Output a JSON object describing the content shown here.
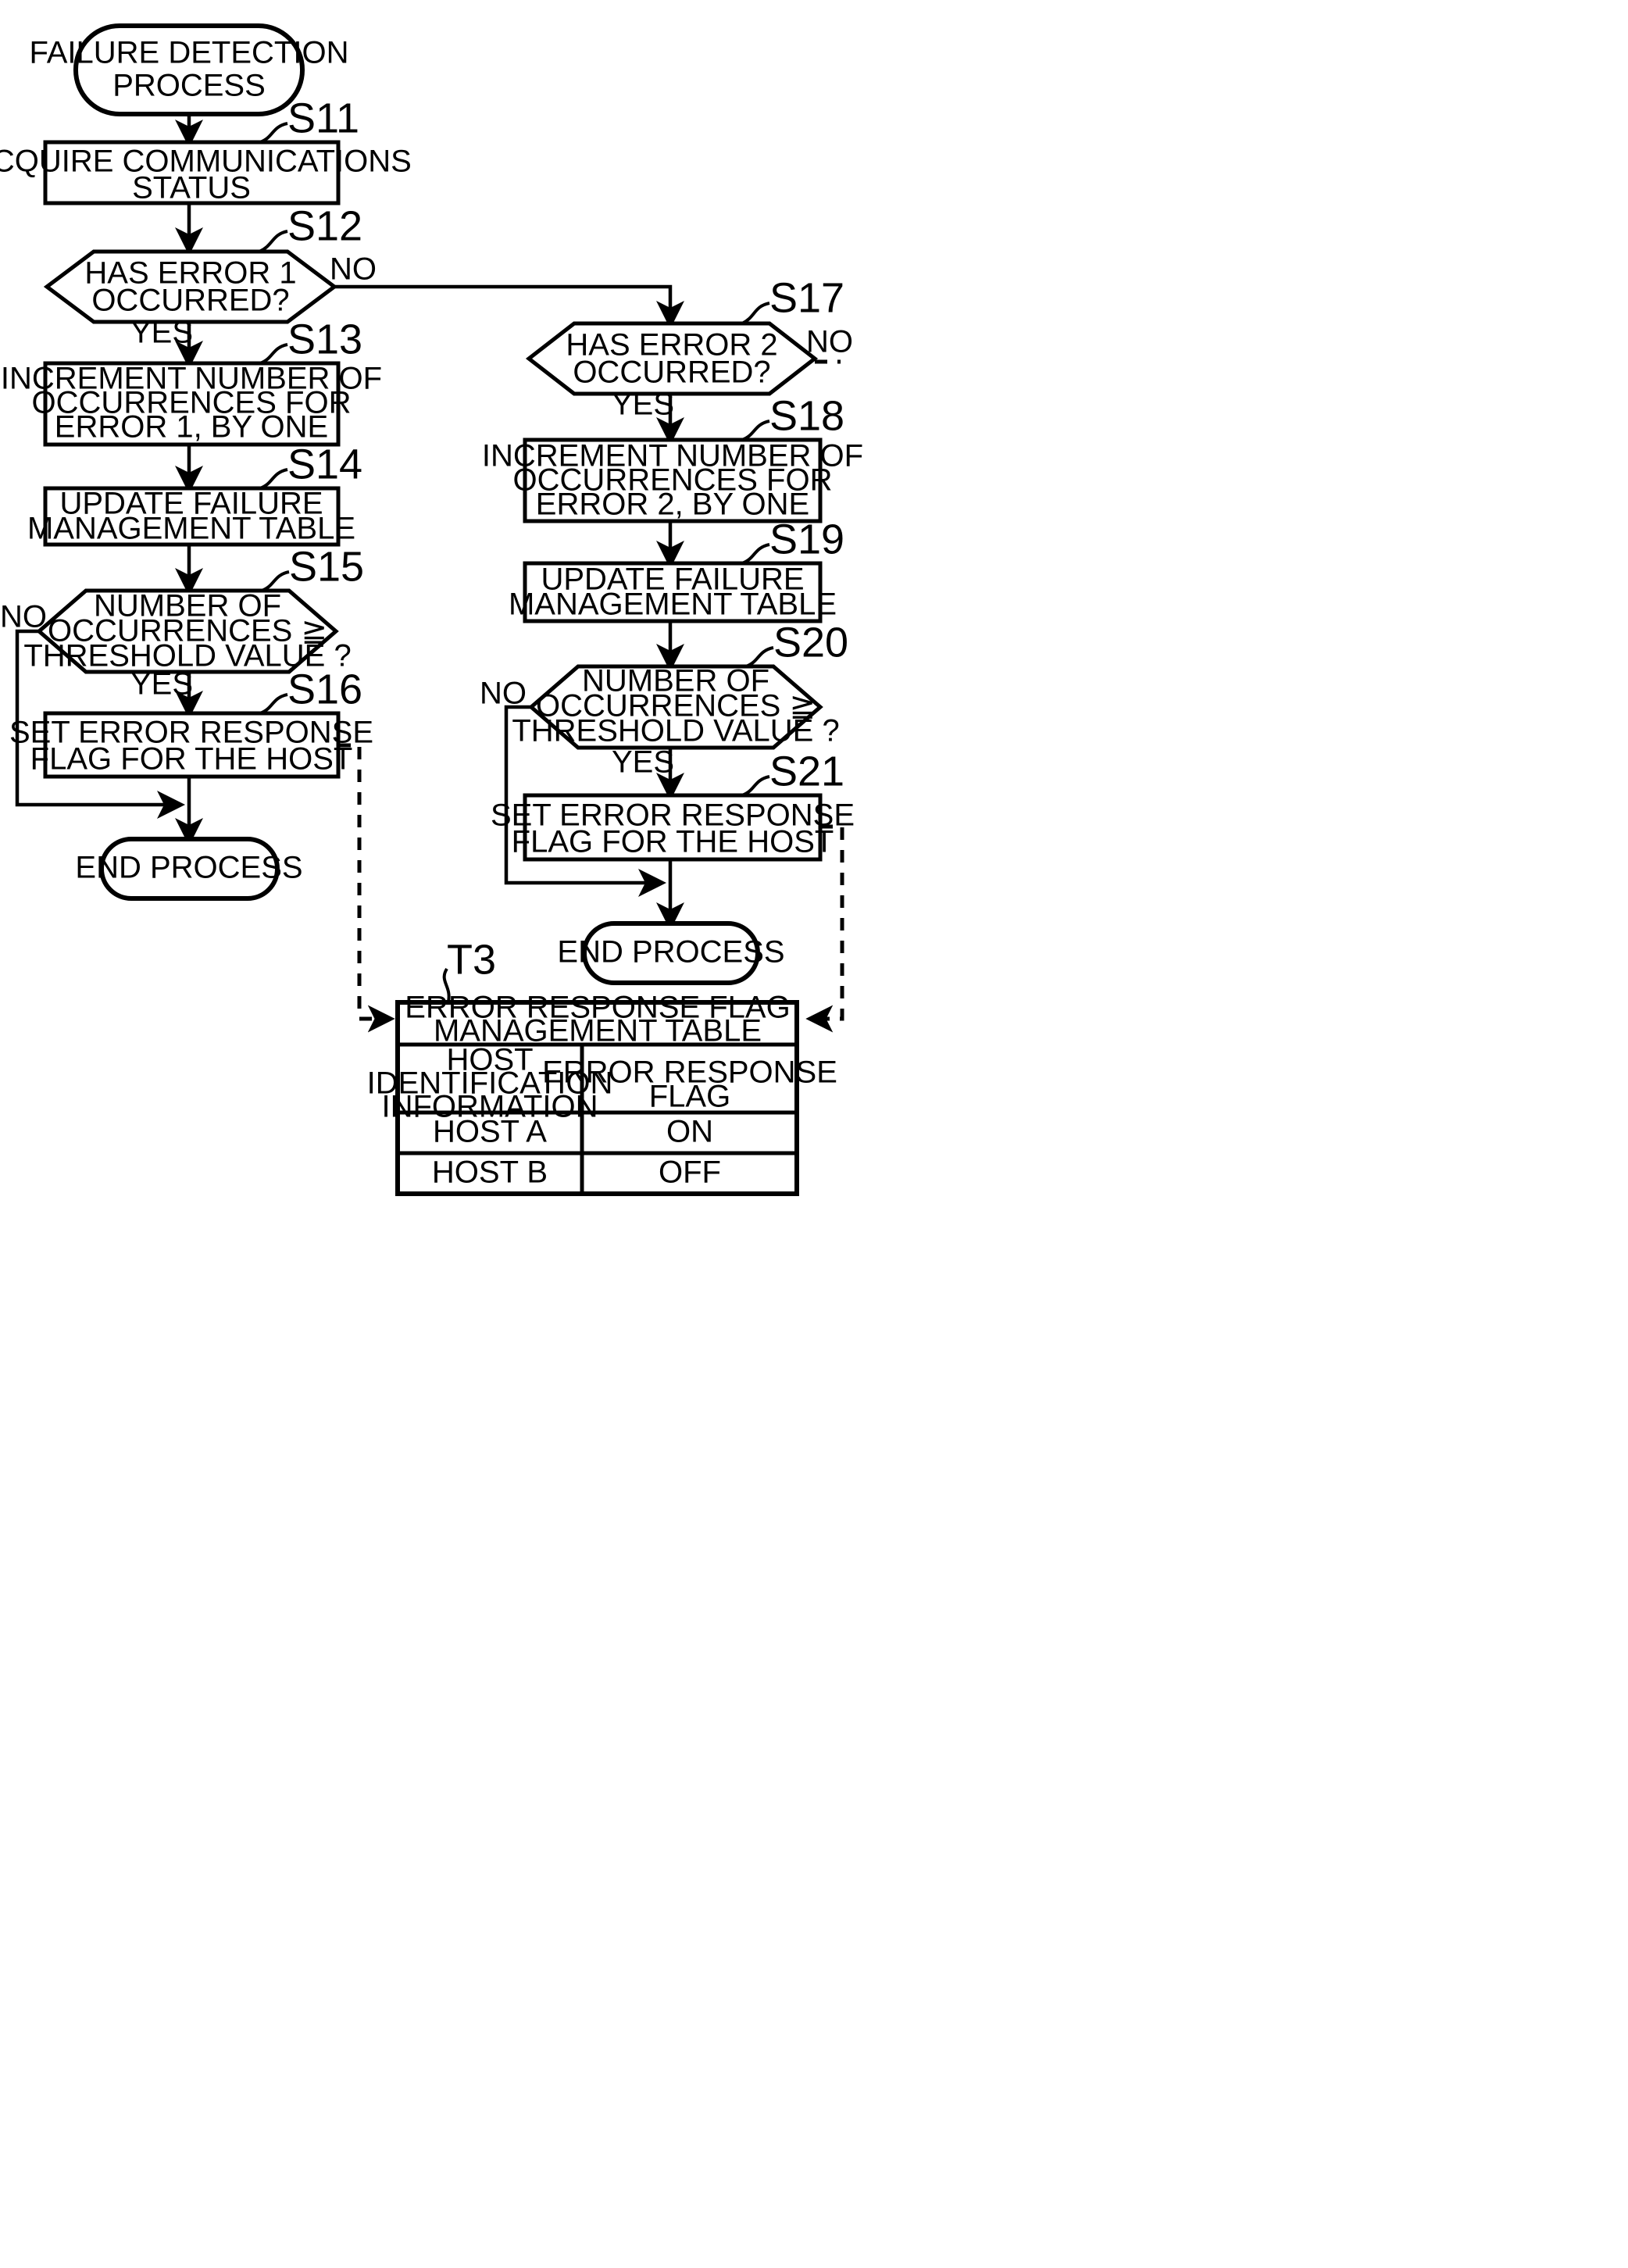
{
  "diagram": {
    "title": "Failure detection process flowchart",
    "start_node": {
      "label": "FAILURE DETECTION PROCESS",
      "lines": [
        "FAILURE DETECTION",
        "PROCESS"
      ]
    },
    "left_column": {
      "s11": {
        "tag": "S11",
        "lines": [
          "ACQUIRE COMMUNICATIONS",
          "STATUS"
        ]
      },
      "s12": {
        "tag": "S12",
        "lines": [
          "HAS ERROR 1",
          "OCCURRED?"
        ],
        "yes_label": "YES",
        "no_label": "NO"
      },
      "s13": {
        "tag": "S13",
        "lines": [
          "INCREMENT NUMBER OF",
          "OCCURRENCES FOR",
          "ERROR 1, BY ONE"
        ]
      },
      "s14": {
        "tag": "S14",
        "lines": [
          "UPDATE FAILURE",
          "MANAGEMENT TABLE"
        ]
      },
      "s15": {
        "tag": "S15",
        "lines": [
          "NUMBER OF",
          "OCCURRENCES ≧",
          "THRESHOLD VALUE ?"
        ],
        "yes_label": "YES",
        "no_label": "NO"
      },
      "s16": {
        "tag": "S16",
        "lines": [
          "SET ERROR RESPONSE",
          "FLAG FOR THE HOST"
        ]
      },
      "end": {
        "label": "END PROCESS"
      }
    },
    "right_column": {
      "s17": {
        "tag": "S17",
        "lines": [
          "HAS ERROR 2",
          "OCCURRED?"
        ],
        "yes_label": "YES",
        "no_label": "NO"
      },
      "s18": {
        "tag": "S18",
        "lines": [
          "INCREMENT NUMBER OF",
          "OCCURRENCES FOR",
          "ERROR 2, BY ONE"
        ]
      },
      "s19": {
        "tag": "S19",
        "lines": [
          "UPDATE FAILURE",
          "MANAGEMENT TABLE"
        ]
      },
      "s20": {
        "tag": "S20",
        "lines": [
          "NUMBER OF",
          "OCCURRENCES ≧",
          "THRESHOLD VALUE ?"
        ],
        "yes_label": "YES",
        "no_label": "NO"
      },
      "s21": {
        "tag": "S21",
        "lines": [
          "SET ERROR RESPONSE",
          "FLAG FOR THE HOST"
        ]
      },
      "end": {
        "label": "END PROCESS"
      }
    },
    "table": {
      "tag": "T3",
      "title_lines": [
        "ERROR RESPONSE FLAG",
        "MANAGEMENT TABLE"
      ],
      "headers": [
        {
          "lines": [
            "HOST",
            "IDENTIFICATION",
            "INFORMATION"
          ]
        },
        {
          "lines": [
            "ERROR RESPONSE",
            "FLAG"
          ]
        }
      ],
      "rows": [
        {
          "host": "HOST A",
          "flag": "ON"
        },
        {
          "host": "HOST B",
          "flag": "OFF"
        }
      ]
    },
    "colors": {
      "stroke": "#000000",
      "fill": "#ffffff"
    }
  }
}
